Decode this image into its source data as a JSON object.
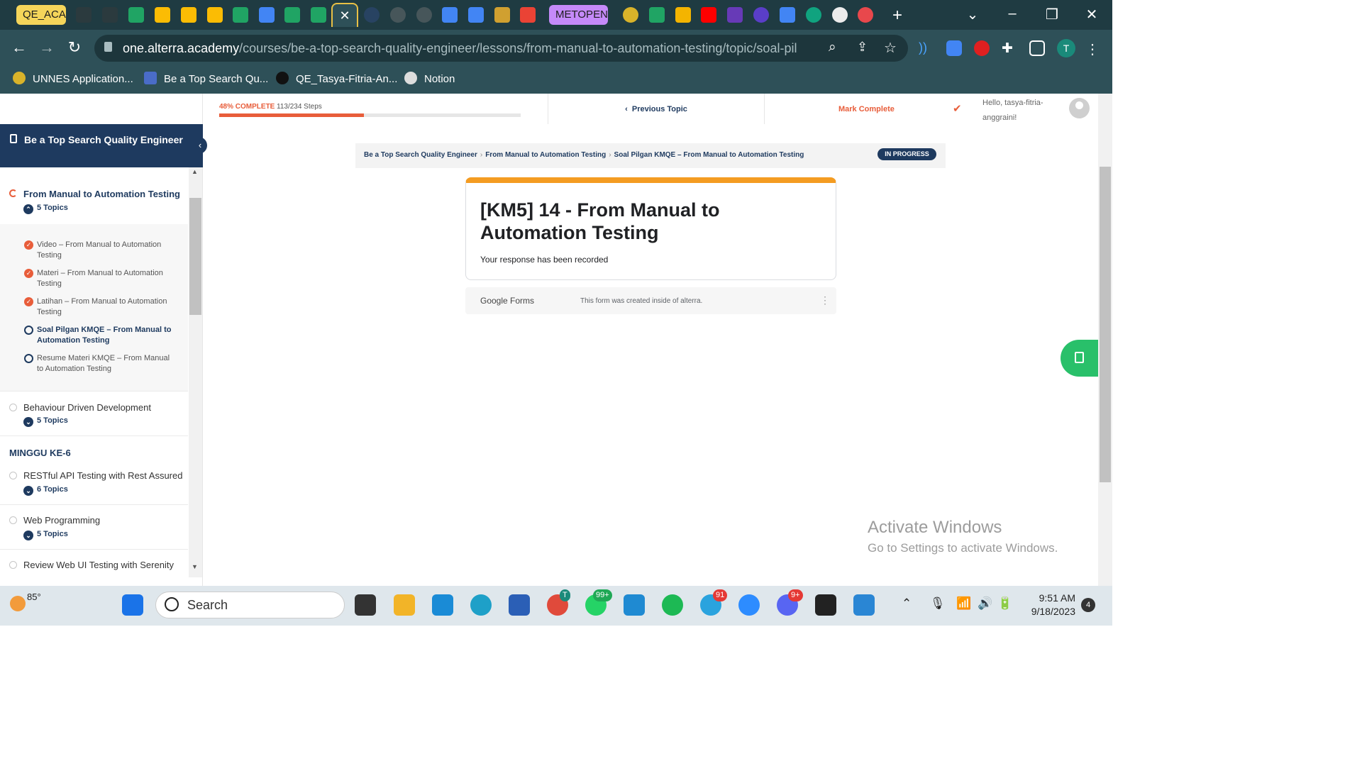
{
  "browser": {
    "tab_groups": [
      {
        "label": "QE_ACA",
        "color": "#f5d55a"
      },
      {
        "label": "METOPEN",
        "color": "#c58af9"
      }
    ],
    "active_tab_close": "✕",
    "new_tab": "+",
    "url_domain": "one.alterra.academy",
    "url_path": "/courses/be-a-top-search-quality-engineer/lessons/from-manual-to-automation-testing/topic/soal-pilgan-...",
    "profile_initial": "T",
    "bookmarks": [
      "UNNES Application...",
      "Be a Top Search Qu...",
      "QE_Tasya-Fitria-An...",
      "Notion"
    ]
  },
  "course_header": {
    "progress_percent": 48,
    "progress_label": "48% COMPLETE",
    "steps": "113/234 Steps",
    "previous_topic": "Previous Topic",
    "mark_complete": "Mark Complete",
    "greeting": "Hello, tasya-fitria-anggraini!"
  },
  "sidebar": {
    "course_title": "Be a Top Search Quality Engineer",
    "current_lesson": {
      "title": "From Manual to Automation Testing",
      "topics_count": "5 Topics",
      "topics": [
        {
          "label": "Video – From Manual to Automation Testing",
          "status": "complete"
        },
        {
          "label": "Materi – From Manual to Automation Testing",
          "status": "complete"
        },
        {
          "label": "Latihan – From Manual to Automation Testing",
          "status": "complete"
        },
        {
          "label": "Soal Pilgan KMQE – From Manual to Automation Testing",
          "status": "current"
        },
        {
          "label": "Resume Materi KMQE – From Manual to Automation Testing",
          "status": "incomplete"
        }
      ]
    },
    "lessons": [
      {
        "title": "Behaviour Driven Development",
        "topics_count": "5 Topics"
      },
      {
        "title": "RESTful API Testing with Rest Assured",
        "topics_count": "6 Topics"
      },
      {
        "title": "Web Programming",
        "topics_count": "5 Topics"
      },
      {
        "title": "Review Web UI Testing with Serenity",
        "topics_count": ""
      }
    ],
    "section_heading": "MINGGU KE-6"
  },
  "breadcrumb": {
    "items": [
      "Be a Top Search Quality Engineer",
      "From Manual to Automation Testing",
      "Soal Pilgan KMQE – From Manual to Automation Testing"
    ],
    "status": "IN PROGRESS"
  },
  "form": {
    "title": "[KM5] 14 - From Manual to Automation Testing",
    "message": "Your response has been recorded",
    "accent_color": "#f49c22",
    "footer_logo": "Google Forms",
    "footer_note": "This form was created inside of alterra."
  },
  "watermark": {
    "line1": "Activate Windows",
    "line2": "Go to Settings to activate Windows."
  },
  "taskbar": {
    "temperature": "85°",
    "search_placeholder": "Search",
    "badges": {
      "chrome": "T",
      "whatsapp": "99+",
      "telegram": "91",
      "discord": "9+"
    },
    "time": "9:51 AM",
    "date": "9/18/2023",
    "notification_count": "4"
  }
}
